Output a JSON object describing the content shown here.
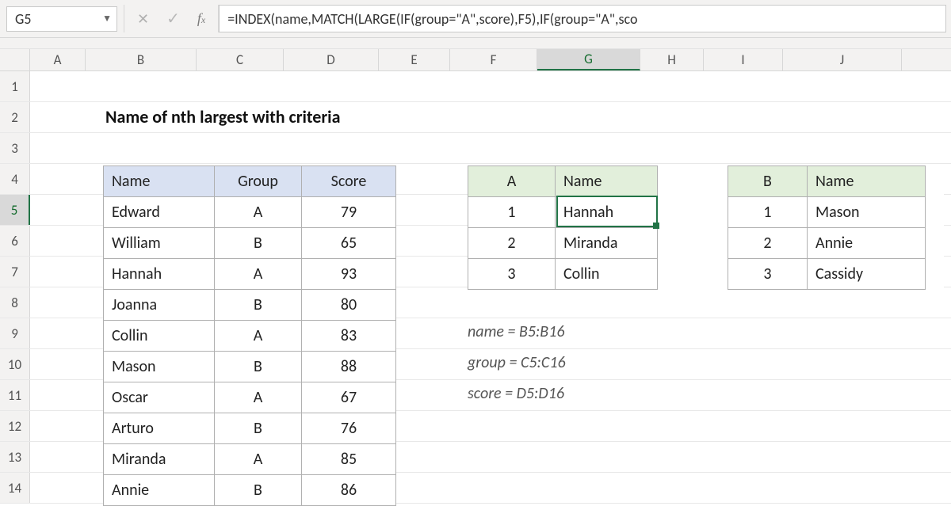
{
  "formula_bar": {
    "cell_ref": "G5",
    "formula": "=INDEX(name,MATCH(LARGE(IF(group=\"A\",score),F5),IF(group=\"A\",sco"
  },
  "title": "Name of nth largest with criteria",
  "columns": [
    "A",
    "B",
    "C",
    "D",
    "E",
    "F",
    "G",
    "H",
    "I",
    "J"
  ],
  "row_numbers": [
    "1",
    "2",
    "3",
    "4",
    "5",
    "6",
    "7",
    "8",
    "9",
    "10",
    "11",
    "12",
    "13",
    "14"
  ],
  "active": {
    "col": "G",
    "row": "5"
  },
  "data_table": {
    "headers": {
      "name": "Name",
      "group": "Group",
      "score": "Score"
    },
    "rows": [
      {
        "name": "Edward",
        "group": "A",
        "score": "79"
      },
      {
        "name": "William",
        "group": "B",
        "score": "65"
      },
      {
        "name": "Hannah",
        "group": "A",
        "score": "93"
      },
      {
        "name": "Joanna",
        "group": "B",
        "score": "80"
      },
      {
        "name": "Collin",
        "group": "A",
        "score": "83"
      },
      {
        "name": "Mason",
        "group": "B",
        "score": "88"
      },
      {
        "name": "Oscar",
        "group": "A",
        "score": "67"
      },
      {
        "name": "Arturo",
        "group": "B",
        "score": "76"
      },
      {
        "name": "Miranda",
        "group": "A",
        "score": "85"
      },
      {
        "name": "Annie",
        "group": "B",
        "score": "86"
      }
    ]
  },
  "result_a": {
    "head_key": "A",
    "head_val": "Name",
    "rows": [
      {
        "n": "1",
        "name": "Hannah"
      },
      {
        "n": "2",
        "name": "Miranda"
      },
      {
        "n": "3",
        "name": "Collin"
      }
    ]
  },
  "result_b": {
    "head_key": "B",
    "head_val": "Name",
    "rows": [
      {
        "n": "1",
        "name": "Mason"
      },
      {
        "n": "2",
        "name": "Annie"
      },
      {
        "n": "3",
        "name": "Cassidy"
      }
    ]
  },
  "notes": {
    "l1": "name = B5:B16",
    "l2": "group = C5:C16",
    "l3": "score = D5:D16"
  }
}
